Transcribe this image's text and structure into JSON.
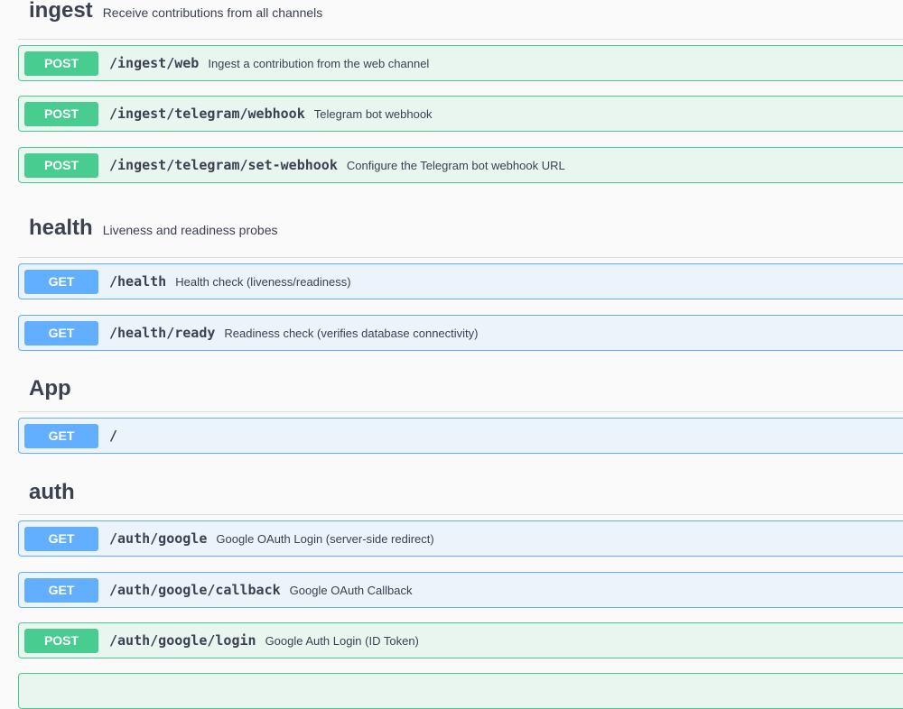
{
  "groups": [
    {
      "name": "ingest",
      "description": "Receive contributions from all channels"
    },
    {
      "name": "health",
      "description": "Liveness and readiness probes"
    },
    {
      "name": "App",
      "description": ""
    },
    {
      "name": "auth",
      "description": ""
    }
  ],
  "operations": [
    {
      "method": "POST",
      "path": "/ingest/web",
      "summary": "Ingest a contribution from the web channel"
    },
    {
      "method": "POST",
      "path": "/ingest/telegram/webhook",
      "summary": "Telegram bot webhook"
    },
    {
      "method": "POST",
      "path": "/ingest/telegram/set-webhook",
      "summary": "Configure the Telegram bot webhook URL"
    },
    {
      "method": "GET",
      "path": "/health",
      "summary": "Health check (liveness/readiness)"
    },
    {
      "method": "GET",
      "path": "/health/ready",
      "summary": "Readiness check (verifies database connectivity)"
    },
    {
      "method": "GET",
      "path": "/",
      "summary": ""
    },
    {
      "method": "GET",
      "path": "/auth/google",
      "summary": "Google OAuth Login (server-side redirect)"
    },
    {
      "method": "GET",
      "path": "/auth/google/callback",
      "summary": "Google OAuth Callback"
    },
    {
      "method": "POST",
      "path": "/auth/google/login",
      "summary": "Google Auth Login (ID Token)"
    }
  ],
  "colors": {
    "post": "#49cc90",
    "get": "#61affe"
  }
}
